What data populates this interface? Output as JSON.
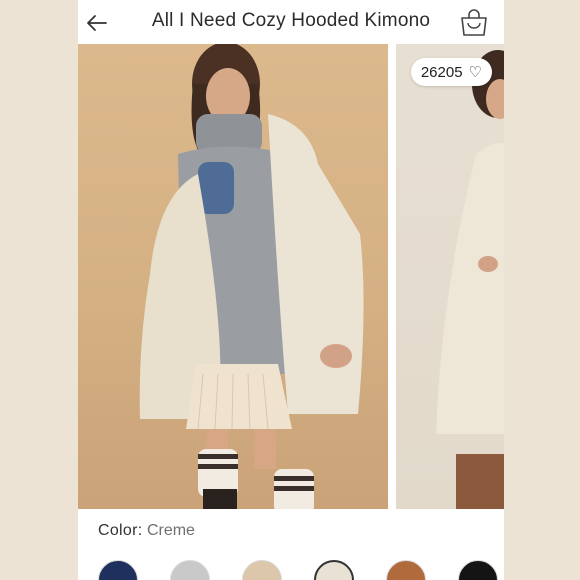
{
  "header": {
    "title": "All I Need Cozy Hooded Kimono"
  },
  "gallery": {
    "like_count": "26205"
  },
  "color": {
    "label": "Color:",
    "value": "Creme"
  },
  "swatches": [
    {
      "name": "navy",
      "color": "#1f2f5e"
    },
    {
      "name": "grey",
      "color": "#c9c9c9"
    },
    {
      "name": "beige",
      "color": "#dcc7ab"
    },
    {
      "name": "creme",
      "color": "#e9e2d4",
      "selected": true
    },
    {
      "name": "rust",
      "color": "#b06a3c"
    },
    {
      "name": "black",
      "color": "#141414"
    }
  ]
}
